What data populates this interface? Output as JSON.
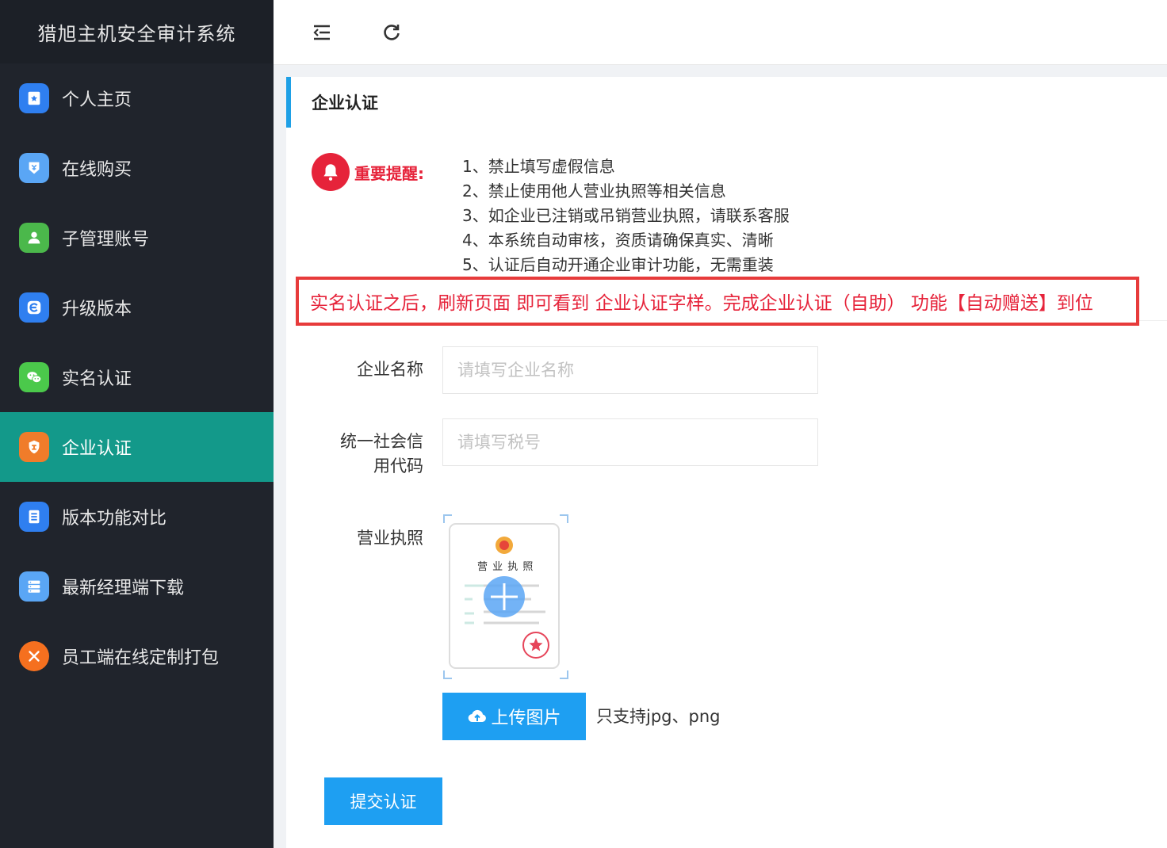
{
  "app": {
    "title": "猎旭主机安全审计系统"
  },
  "sidebar": {
    "items": [
      {
        "label": "个人主页",
        "icon": "home-icon",
        "color": "#2f7ff0"
      },
      {
        "label": "在线购买",
        "icon": "shop-icon",
        "color": "#5aa6f5"
      },
      {
        "label": "子管理账号",
        "icon": "user-icon",
        "color": "#4bb84b"
      },
      {
        "label": "升级版本",
        "icon": "upgrade-icon",
        "color": "#2f7ff0"
      },
      {
        "label": "实名认证",
        "icon": "wechat-icon",
        "color": "#4bc94b"
      },
      {
        "label": "企业认证",
        "icon": "enterprise-shield-icon",
        "color": "#f07c2a",
        "active": true
      },
      {
        "label": "版本功能对比",
        "icon": "document-icon",
        "color": "#2f7ff0"
      },
      {
        "label": "最新经理端下载",
        "icon": "server-icon",
        "color": "#5aa6f5"
      },
      {
        "label": "员工端在线定制打包",
        "icon": "tools-icon",
        "color": "#f5701f"
      }
    ]
  },
  "header": {
    "collapse_icon": "menu-collapse-icon",
    "refresh_icon": "refresh-icon"
  },
  "page": {
    "title": "企业认证",
    "notice": {
      "label": "重要提醒:",
      "items": [
        "1、禁止填写虚假信息",
        "2、禁止使用他人营业执照等相关信息",
        "3、如企业已注销或吊销营业执照，请联系客服",
        "4、本系统自动审核，资质请确保真实、清晰",
        "5、认证后自动开通企业审计功能，无需重装"
      ]
    },
    "banner": "实名认证之后，刷新页面 即可看到 企业认证字样。完成企业认证（自助） 功能【自动赠送】到位",
    "form": {
      "company_name_label": "企业名称",
      "company_name_placeholder": "请填写企业名称",
      "credit_code_label_line1": "统一社会信",
      "credit_code_label_line2": "用代码",
      "credit_code_placeholder": "请填写税号",
      "license_label": "营业执照",
      "license_image_text": "营 业 执 照",
      "upload_label": "上传图片",
      "upload_hint": "只支持jpg、png",
      "submit_label": "提交认证"
    }
  },
  "colors": {
    "accent": "#1e9ff2",
    "active_nav": "#13998a",
    "warning": "#e6233a"
  }
}
